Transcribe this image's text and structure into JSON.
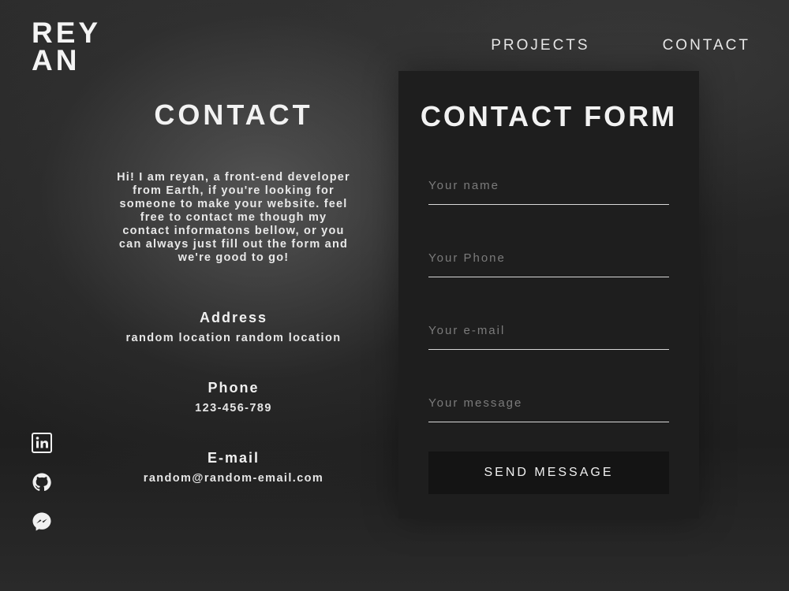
{
  "logo": {
    "line1": "REY",
    "line2": "AN"
  },
  "nav": {
    "projects": "PROJECTS",
    "contact": "CONTACT"
  },
  "info": {
    "title": "CONTACT",
    "intro": "Hi! I am reyan, a front-end developer from Earth, if you're looking for someone to make your website. feel free to contact me though my contact informatons bellow, or you can always just fill out the form and we're good to go!",
    "address": {
      "label": "Address",
      "value": "random location random location"
    },
    "phone": {
      "label": "Phone",
      "value": "123-456-789"
    },
    "email": {
      "label": "E-mail",
      "value": "random@random-email.com"
    }
  },
  "form": {
    "title": "CONTACT FORM",
    "name_placeholder": "Your name",
    "phone_placeholder": "Your Phone",
    "email_placeholder": "Your e-mail",
    "message_placeholder": "Your message",
    "submit_label": "SEND MESSAGE"
  },
  "social": {
    "icons": [
      "linkedin-icon",
      "github-icon",
      "messenger-icon"
    ]
  },
  "colors": {
    "panel_bg": "#1e1e1e",
    "button_bg": "#141414",
    "text": "#f0f0f0",
    "placeholder": "#7b7b7b"
  }
}
